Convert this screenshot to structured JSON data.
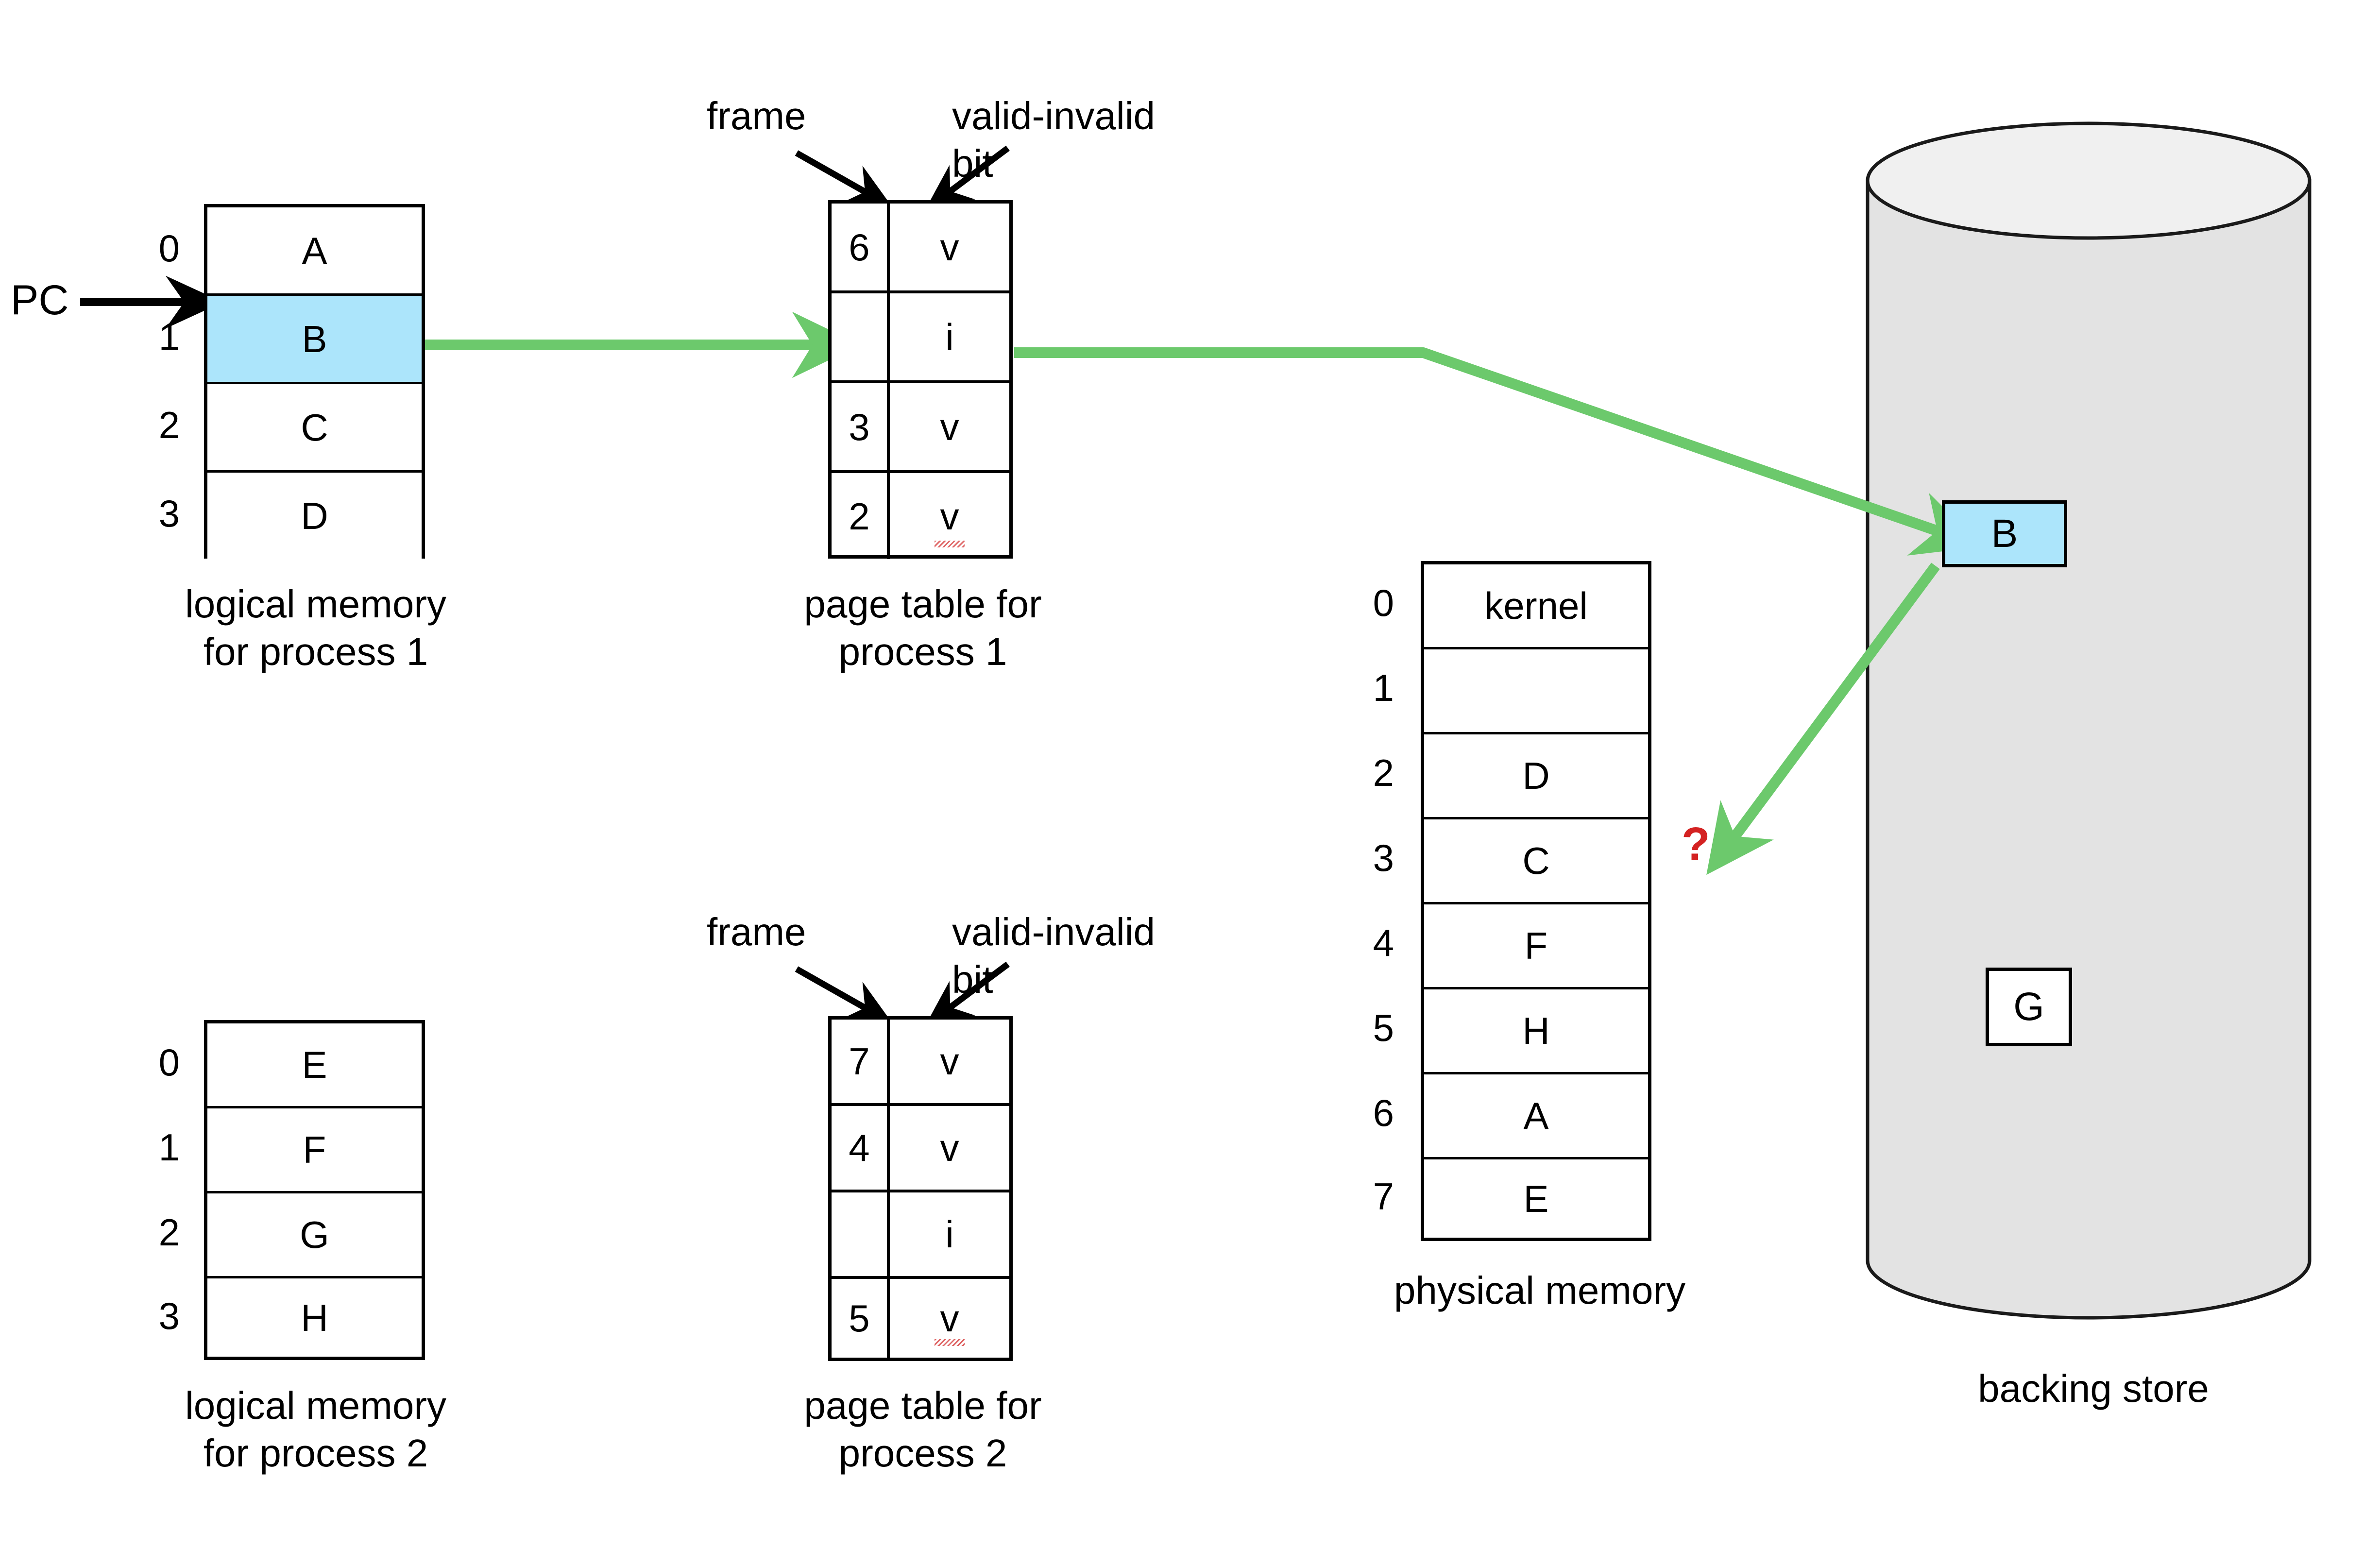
{
  "colors": {
    "highlight_blue": "#ACE5FB",
    "arrow_green": "#6CC96C",
    "question_red": "#D42222",
    "cylinder_gray": "#E3E3E3",
    "line_black": "#000000"
  },
  "logical_memory_1": {
    "caption": "logical memory\nfor process 1",
    "indices": [
      "0",
      "1",
      "2",
      "3"
    ],
    "cells": [
      {
        "value": "A",
        "highlighted": false
      },
      {
        "value": "B",
        "highlighted": true
      },
      {
        "value": "C",
        "highlighted": false
      },
      {
        "value": "D",
        "highlighted": false
      }
    ]
  },
  "pc_pointer": {
    "label": "PC",
    "points_to_index": "1"
  },
  "page_table_1": {
    "caption": "page table for\nprocess 1",
    "frame_label": "frame",
    "valid_label": "valid-invalid\nbit",
    "rows": [
      {
        "frame": "6",
        "bit": "v",
        "spellcheck_underline": false
      },
      {
        "frame": "",
        "bit": "i",
        "spellcheck_underline": false
      },
      {
        "frame": "3",
        "bit": "v",
        "spellcheck_underline": false
      },
      {
        "frame": "2",
        "bit": "v",
        "spellcheck_underline": true
      }
    ]
  },
  "logical_memory_2": {
    "caption": "logical memory\nfor process 2",
    "indices": [
      "0",
      "1",
      "2",
      "3"
    ],
    "cells": [
      {
        "value": "E",
        "highlighted": false
      },
      {
        "value": "F",
        "highlighted": false
      },
      {
        "value": "G",
        "highlighted": false
      },
      {
        "value": "H",
        "highlighted": false
      }
    ]
  },
  "page_table_2": {
    "caption": "page table for\nprocess 2",
    "frame_label": "frame",
    "valid_label": "valid-invalid\nbit",
    "rows": [
      {
        "frame": "7",
        "bit": "v",
        "spellcheck_underline": false
      },
      {
        "frame": "4",
        "bit": "v",
        "spellcheck_underline": false
      },
      {
        "frame": "",
        "bit": "i",
        "spellcheck_underline": false
      },
      {
        "frame": "5",
        "bit": "v",
        "spellcheck_underline": true
      }
    ]
  },
  "physical_memory": {
    "caption": "physical memory",
    "indices": [
      "0",
      "1",
      "2",
      "3",
      "4",
      "5",
      "6",
      "7"
    ],
    "frames": [
      {
        "value": "kernel",
        "has_down_arrow": false
      },
      {
        "value": "",
        "has_down_arrow": true
      },
      {
        "value": "D",
        "has_down_arrow": false
      },
      {
        "value": "C",
        "has_down_arrow": false
      },
      {
        "value": "F",
        "has_down_arrow": false
      },
      {
        "value": "H",
        "has_down_arrow": false
      },
      {
        "value": "A",
        "has_down_arrow": false
      },
      {
        "value": "E",
        "has_down_arrow": false
      }
    ]
  },
  "backing_store": {
    "caption": "backing store",
    "pages": [
      {
        "value": "B",
        "highlighted": true
      },
      {
        "value": "G",
        "highlighted": false
      }
    ]
  },
  "page_fault_marker": {
    "symbol": "?"
  }
}
